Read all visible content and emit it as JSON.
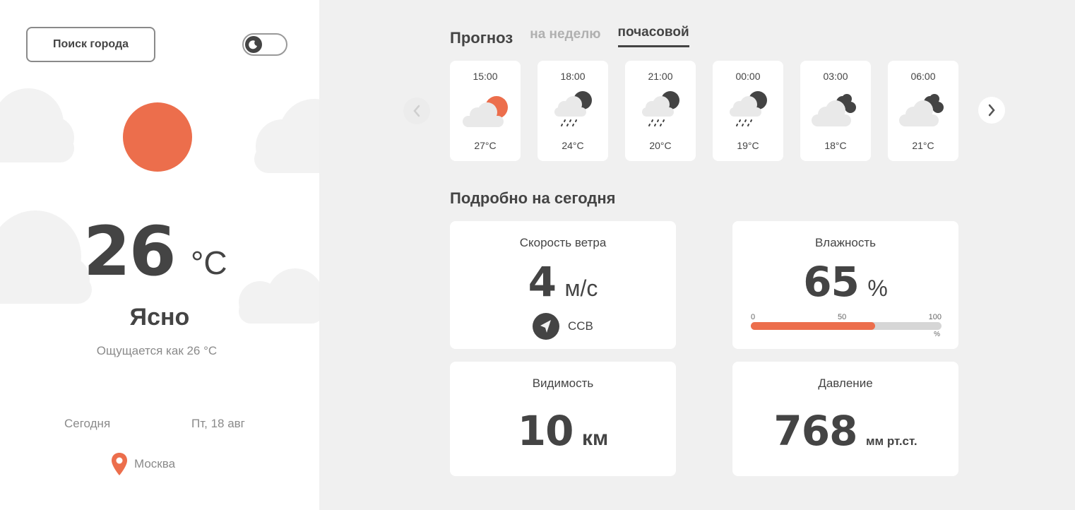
{
  "left": {
    "search_label": "Поиск города",
    "temperature": "26",
    "temp_unit": "°C",
    "condition": "Ясно",
    "feels_like": "Ощущается как 26 °C",
    "today_label": "Сегодня",
    "date": "Пт, 18 авг",
    "location": "Москва"
  },
  "forecast": {
    "title": "Прогноз",
    "tabs": [
      {
        "label": "на неделю",
        "active": false
      },
      {
        "label": "почасовой",
        "active": true
      }
    ],
    "hours": [
      {
        "time": "15:00",
        "temp": "27°C",
        "icon": "partly-sunny-icon"
      },
      {
        "time": "18:00",
        "temp": "24°C",
        "icon": "night-rain-icon"
      },
      {
        "time": "21:00",
        "temp": "20°C",
        "icon": "night-rain-icon"
      },
      {
        "time": "00:00",
        "temp": "19°C",
        "icon": "night-rain-icon"
      },
      {
        "time": "03:00",
        "temp": "18°C",
        "icon": "night-cloudy-icon"
      },
      {
        "time": "06:00",
        "temp": "21°C",
        "icon": "night-cloudy-icon"
      }
    ]
  },
  "details": {
    "title": "Подробно на сегодня",
    "wind": {
      "label": "Скорость ветра",
      "value": "4",
      "unit": "м/с",
      "direction": "ССВ"
    },
    "humidity": {
      "label": "Влажность",
      "value": "65",
      "unit": "%",
      "scale": [
        "0",
        "50",
        "100"
      ],
      "scale_unit": "%",
      "fraction": 0.65
    },
    "visibility": {
      "label": "Видимость",
      "value": "10",
      "unit": "км"
    },
    "pressure": {
      "label": "Давление",
      "value": "768",
      "unit": "мм рт.ст."
    }
  },
  "colors": {
    "accent": "#ec6e4c",
    "text": "#444444",
    "muted": "#8a8a8a",
    "background": "#f0f0f0"
  }
}
